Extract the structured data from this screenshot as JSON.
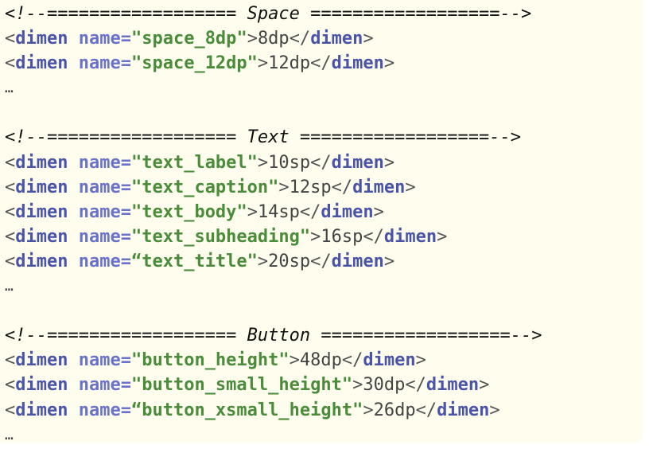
{
  "sections": [
    {
      "header": "<!--================== Space ==================-->",
      "entries": [
        {
          "open_quote": "\"",
          "name": "space_8dp",
          "close_quote": "\"",
          "value": "8dp"
        },
        {
          "open_quote": "\"",
          "name": "space_12dp",
          "close_quote": "\"",
          "value": "12dp"
        }
      ],
      "ellipsis": "…"
    },
    {
      "header": "<!--================== Text ==================-->",
      "entries": [
        {
          "open_quote": "\"",
          "name": "text_label",
          "close_quote": "\"",
          "value": "10sp"
        },
        {
          "open_quote": "\"",
          "name": "text_caption",
          "close_quote": "\"",
          "value": "12sp"
        },
        {
          "open_quote": "\"",
          "name": "text_body",
          "close_quote": "\"",
          "value": "14sp"
        },
        {
          "open_quote": "\"",
          "name": "text_subheading",
          "close_quote": "\"",
          "value": "16sp"
        },
        {
          "open_quote": "“",
          "name": "text_title",
          "close_quote": "\"",
          "value": "20sp"
        }
      ],
      "ellipsis": "…"
    },
    {
      "header": "<!--================== Button ==================-->",
      "entries": [
        {
          "open_quote": "\"",
          "name": "button_height",
          "close_quote": "\"",
          "value": "48dp"
        },
        {
          "open_quote": "\"",
          "name": "button_small_height",
          "close_quote": "\"",
          "value": "30dp"
        },
        {
          "open_quote": "“",
          "name": "button_xsmall_height",
          "close_quote": "\"",
          "value": "26dp"
        }
      ],
      "ellipsis": "…"
    }
  ],
  "tokens": {
    "tag_open": "<",
    "tag_name": "dimen",
    "attr_name": "name=",
    "tag_close": ">",
    "end_tag_open": "</",
    "end_tag_close": ">"
  }
}
